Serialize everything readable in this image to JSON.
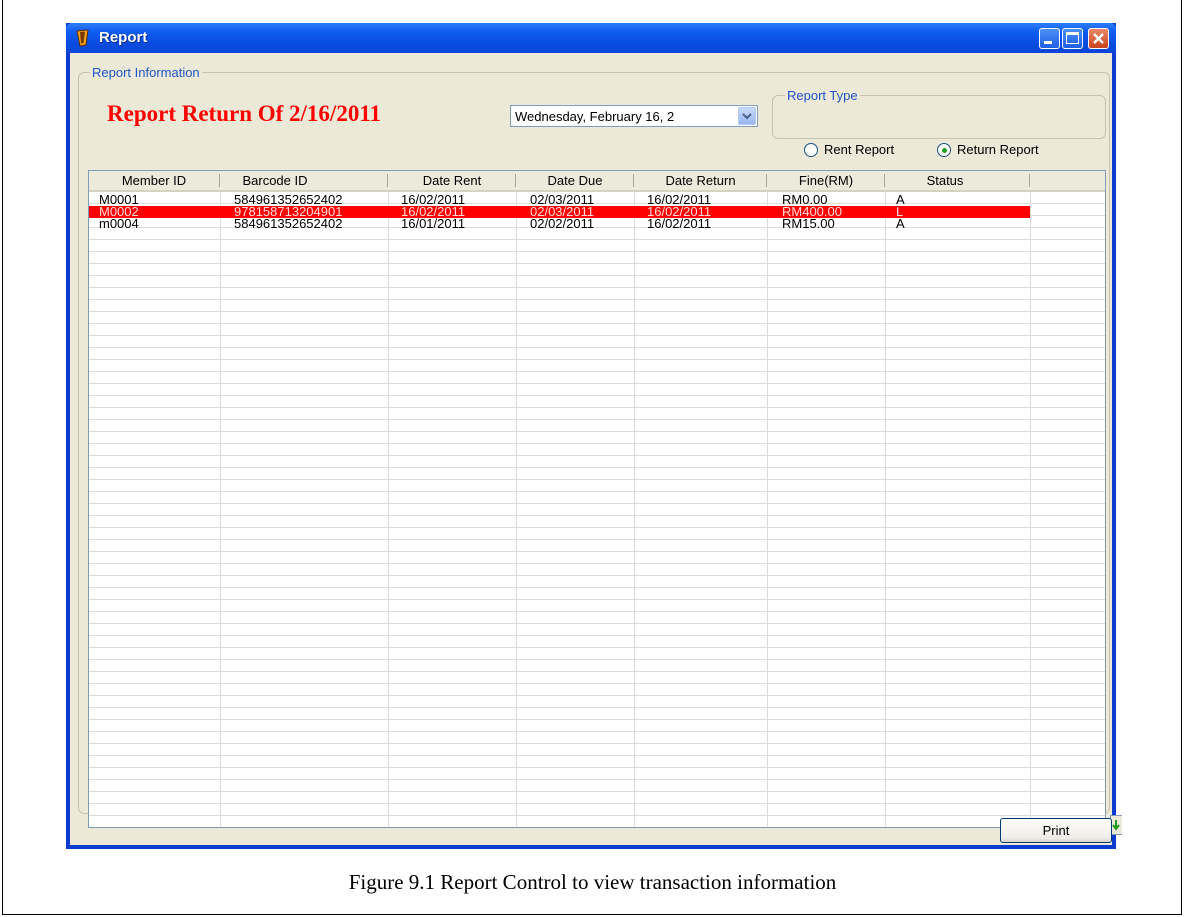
{
  "window": {
    "title": "Report",
    "minimize_icon": "minimize-icon",
    "maximize_icon": "maximize-icon",
    "close_icon": "close-icon"
  },
  "report_info": {
    "legend": "Report Information",
    "heading": "Report Return Of 2/16/2011",
    "date_value": "Wednesday,  February  16, 2"
  },
  "report_type": {
    "legend": "Report Type",
    "options": [
      {
        "label": "Rent Report",
        "selected": false
      },
      {
        "label": "Return Report",
        "selected": true
      }
    ]
  },
  "table": {
    "columns": [
      "Member ID",
      "Barcode ID",
      "Date Rent",
      "Date Due",
      "Date Return",
      "Fine(RM)",
      "Status"
    ],
    "rows": [
      {
        "member_id": "M0001",
        "barcode_id": "584961352652402",
        "date_rent": "16/02/2011",
        "date_due": "02/03/2011",
        "date_return": "16/02/2011",
        "fine": "RM0.00",
        "status": "A",
        "highlight": false
      },
      {
        "member_id": "M0002",
        "barcode_id": "978158713204901",
        "date_rent": "16/02/2011",
        "date_due": "02/03/2011",
        "date_return": "16/02/2011",
        "fine": "RM400.00",
        "status": "L",
        "highlight": true
      },
      {
        "member_id": "m0004",
        "barcode_id": "584961352652402",
        "date_rent": "16/01/2011",
        "date_due": "02/02/2011",
        "date_return": "16/02/2011",
        "fine": "RM15.00",
        "status": "A",
        "highlight": false
      }
    ],
    "highlight_color": "#ff0000"
  },
  "buttons": {
    "print": "Print"
  },
  "caption": "Figure 9.1 Report Control to view transaction information",
  "colors": {
    "titlebar": "#0a4be0",
    "heading": "#ff0000",
    "legend_text": "#2155c8",
    "client_bg": "#ece9d8"
  }
}
